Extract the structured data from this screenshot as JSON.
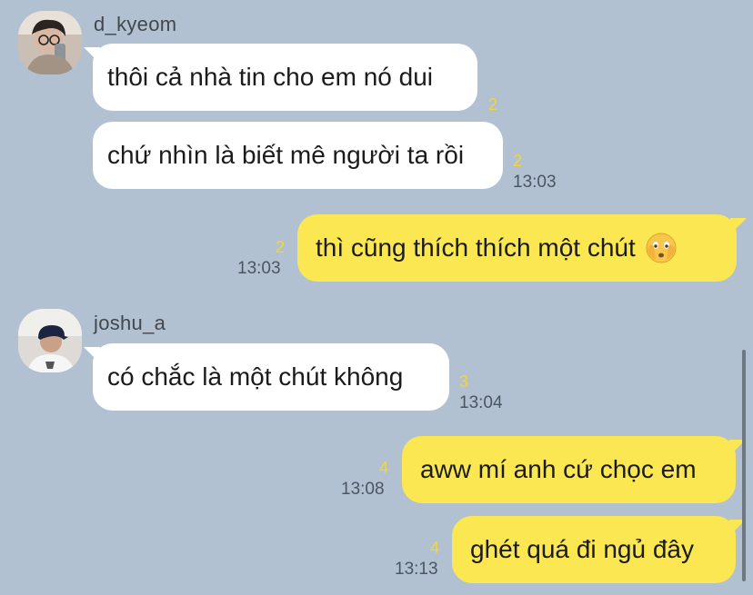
{
  "messages": [
    {
      "sender": "d_kyeom",
      "text": "thôi cả nhà tin cho em nó dui",
      "unread": "2"
    },
    {
      "text": "chứ nhìn là biết mê người ta rồi",
      "unread": "2",
      "time": "13:03"
    },
    {
      "text": "thì cũng thích thích một chút",
      "emoji": "shy-face-emoji",
      "unread": "2",
      "time": "13:03"
    },
    {
      "sender": "joshu_a",
      "text": "có chắc là một chút không",
      "unread": "3",
      "time": "13:04"
    },
    {
      "text": "aww mí anh cứ chọc em",
      "unread": "4",
      "time": "13:08"
    },
    {
      "text": "ghét quá đi ngủ đây",
      "unread": "4",
      "time": "13:13"
    }
  ],
  "colors": {
    "background": "#b1c1d1",
    "incoming_bubble": "#ffffff",
    "outgoing_bubble": "#fae751",
    "unread_count": "#f5d533"
  }
}
